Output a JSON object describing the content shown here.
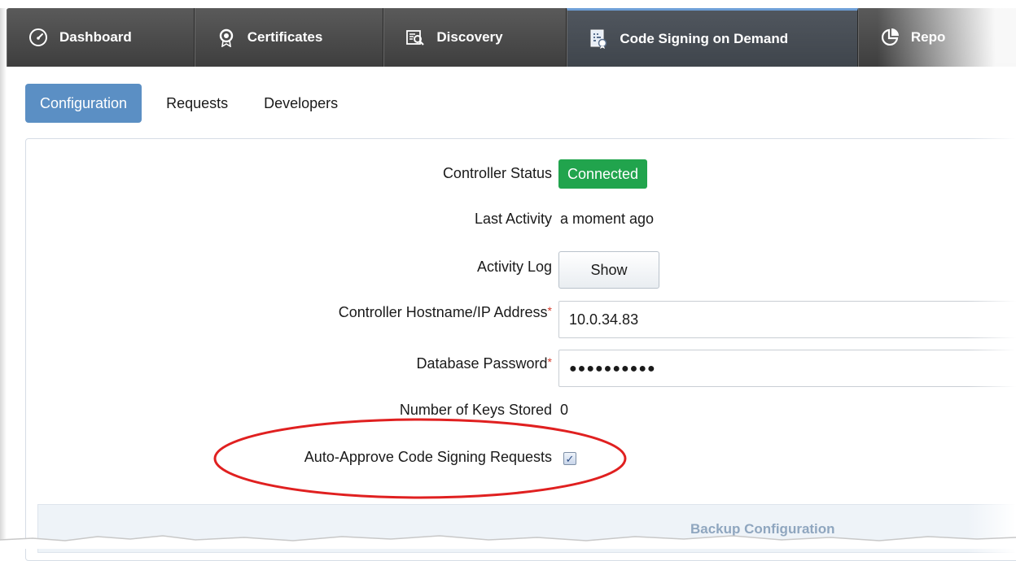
{
  "topnav": {
    "items": [
      {
        "label": "Dashboard",
        "icon": "speedometer-icon",
        "active": false
      },
      {
        "label": "Certificates",
        "icon": "certificate-badge-icon",
        "active": false
      },
      {
        "label": "Discovery",
        "icon": "magnifier-list-icon",
        "active": false
      },
      {
        "label": "Code Signing on Demand",
        "icon": "code-signing-icon",
        "active": true
      },
      {
        "label": "Repo",
        "icon": "pie-chart-icon",
        "active": false
      }
    ]
  },
  "subtabs": [
    {
      "label": "Configuration",
      "active": true
    },
    {
      "label": "Requests",
      "active": false
    },
    {
      "label": "Developers",
      "active": false
    }
  ],
  "form": {
    "controller_status": {
      "label": "Controller Status",
      "value": "Connected",
      "color": "#21a44d"
    },
    "last_activity": {
      "label": "Last Activity",
      "value": "a moment ago"
    },
    "activity_log": {
      "label": "Activity Log",
      "button": "Show"
    },
    "hostname": {
      "label": "Controller Hostname/IP Address",
      "required": "*",
      "value": "10.0.34.83"
    },
    "db_password": {
      "label": "Database Password",
      "required": "*",
      "value": "●●●●●●●●●●"
    },
    "keys_stored": {
      "label": "Number of Keys Stored",
      "value": "0"
    },
    "auto_approve": {
      "label": "Auto-Approve Code Signing Requests",
      "checked": true
    }
  },
  "backup": {
    "title": "Backup Configuration"
  },
  "colors": {
    "nav_bg": "#4a4a4a",
    "accent": "#5b8fc4",
    "callout": "#e02020"
  }
}
